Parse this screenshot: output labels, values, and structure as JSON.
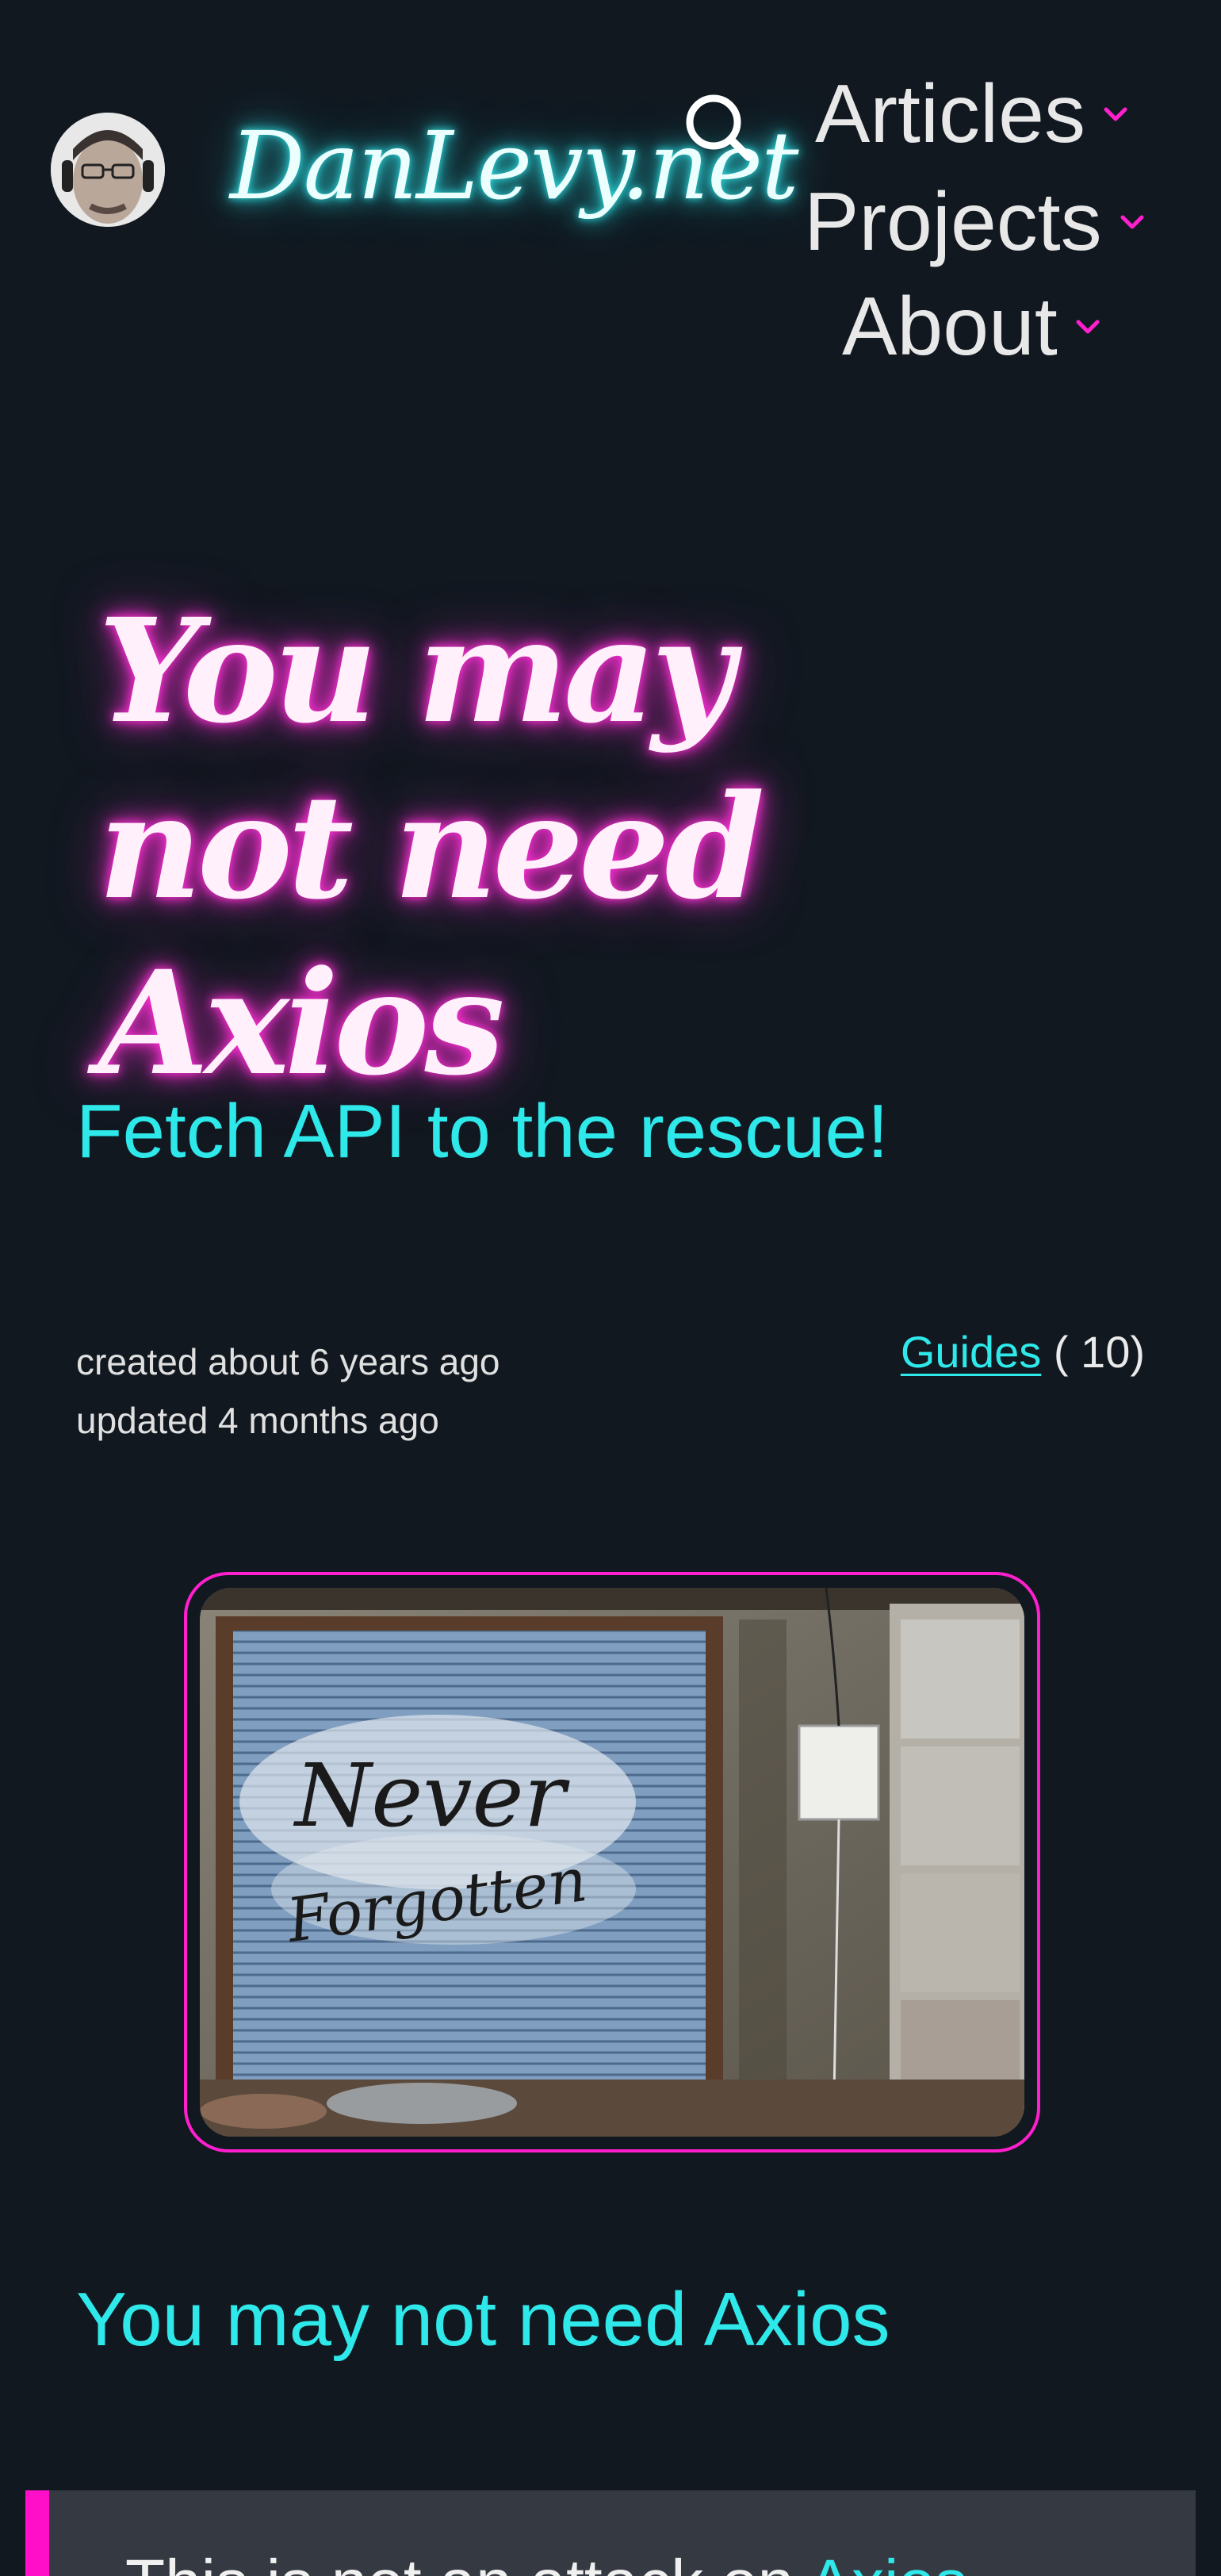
{
  "header": {
    "site_title": "DanLevy.net",
    "nav": [
      {
        "label": "Articles"
      },
      {
        "label": "Projects"
      },
      {
        "label": "About"
      }
    ]
  },
  "article": {
    "title": "You may not need Axios",
    "subtitle": "Fetch API to the rescue!",
    "created": "created about 6 years ago",
    "updated": "updated 4 months ago",
    "category_link": "Guides",
    "category_count": "( 10)",
    "image_text": [
      "Never",
      "Forgotten"
    ],
    "section_heading": "You may not need Axios",
    "callout_text_start": "This is not an attack on ",
    "callout_text_link": "Axios"
  },
  "colors": {
    "background": "#111820",
    "accent_cyan": "#2ee8ea",
    "accent_magenta": "#ff1fce",
    "callout_bg": "#353a42"
  },
  "icons": {
    "search": "search-icon",
    "chevron": "chevron-down-icon"
  }
}
